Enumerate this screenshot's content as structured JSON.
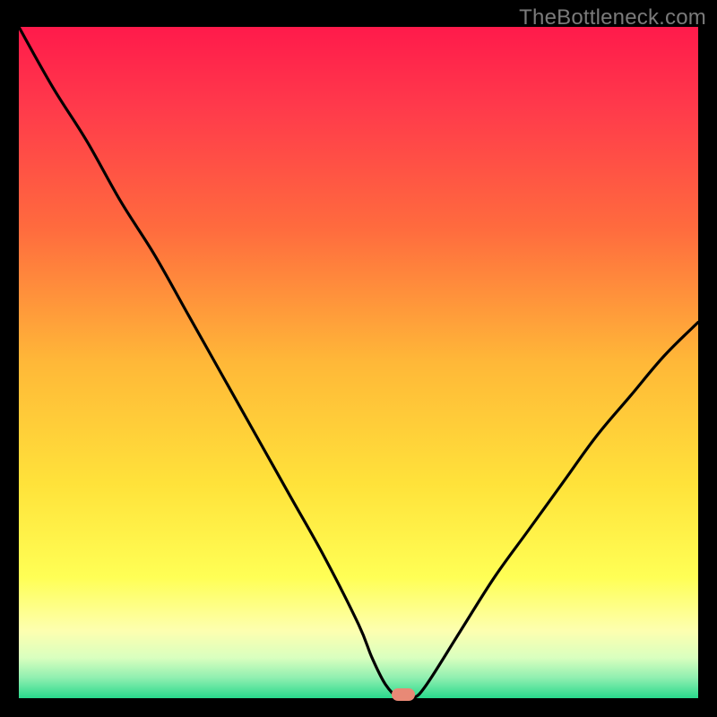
{
  "watermark": {
    "text": "TheBottleneck.com"
  },
  "chart_data": {
    "type": "line",
    "title": "",
    "xlabel": "",
    "ylabel": "",
    "xlim": [
      0,
      100
    ],
    "ylim": [
      0,
      100
    ],
    "x": [
      0,
      5,
      10,
      15,
      20,
      25,
      30,
      35,
      40,
      45,
      50,
      52,
      54,
      56,
      58,
      60,
      65,
      70,
      75,
      80,
      85,
      90,
      95,
      100
    ],
    "values": [
      100,
      91,
      83,
      74,
      66,
      57,
      48,
      39,
      30,
      21,
      11,
      6,
      2,
      0,
      0,
      2,
      10,
      18,
      25,
      32,
      39,
      45,
      51,
      56
    ],
    "marker": {
      "x_frac": 0.566,
      "y_frac": 0.994
    },
    "gradient_stops": [
      {
        "pos": 0.0,
        "color": "#ff1a4b"
      },
      {
        "pos": 0.12,
        "color": "#ff3a4b"
      },
      {
        "pos": 0.3,
        "color": "#ff6b3e"
      },
      {
        "pos": 0.5,
        "color": "#ffb838"
      },
      {
        "pos": 0.68,
        "color": "#ffe23a"
      },
      {
        "pos": 0.82,
        "color": "#ffff55"
      },
      {
        "pos": 0.9,
        "color": "#fdffb0"
      },
      {
        "pos": 0.94,
        "color": "#d9ffbf"
      },
      {
        "pos": 0.97,
        "color": "#8fefb0"
      },
      {
        "pos": 1.0,
        "color": "#29d98c"
      }
    ]
  }
}
